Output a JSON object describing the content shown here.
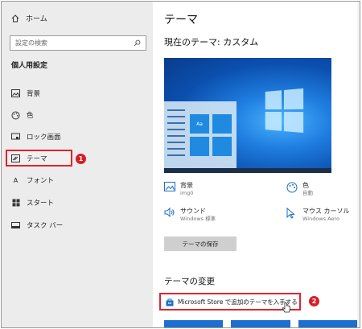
{
  "sidebar": {
    "home_label": "ホーム",
    "search_placeholder": "設定の検索",
    "section_title": "個人用設定",
    "items": [
      {
        "label": "背景",
        "icon": "image-icon"
      },
      {
        "label": "色",
        "icon": "palette-icon"
      },
      {
        "label": "ロック画面",
        "icon": "lock-screen-icon"
      },
      {
        "label": "テーマ",
        "icon": "theme-icon",
        "selected": true
      },
      {
        "label": "フォント",
        "icon": "font-icon"
      },
      {
        "label": "スタート",
        "icon": "start-icon"
      },
      {
        "label": "タスク バー",
        "icon": "taskbar-icon"
      }
    ]
  },
  "main": {
    "page_title": "テーマ",
    "current_theme": "現在のテーマ: カスタム",
    "preview_tile_label": "Aa",
    "props": {
      "background": {
        "title": "背景",
        "value": "img0"
      },
      "color": {
        "title": "色",
        "value": "自動"
      },
      "sound": {
        "title": "サウンド",
        "value": "Windows 標準"
      },
      "cursor": {
        "title": "マウス カーソル",
        "value": "Windows Aero"
      }
    },
    "save_button": "テーマの保存",
    "change_title": "テーマの変更",
    "store_link": "Microsoft Store で追加のテーマを入手する"
  },
  "annotations": {
    "badge1": "1",
    "badge2": "2"
  },
  "colors": {
    "accent_red": "#e0242e",
    "badge_red": "#d61f26",
    "preview_blue": "#0d63c6",
    "sidebar_bg": "#ececec"
  }
}
